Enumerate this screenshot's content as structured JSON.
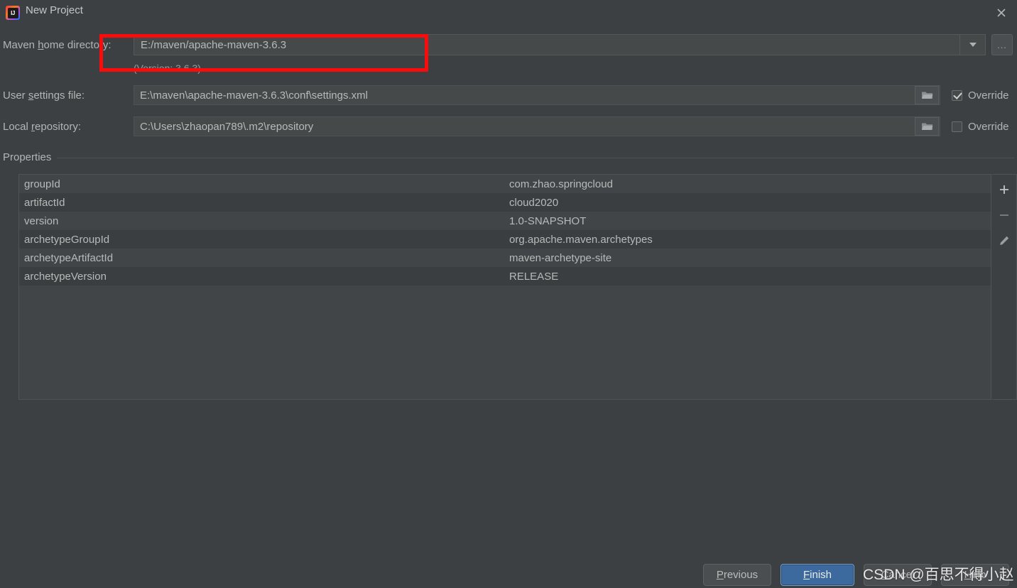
{
  "window": {
    "title": "New Project",
    "app_icon": "intellij-idea-icon",
    "close_icon": "close-icon"
  },
  "form": {
    "maven_home": {
      "label_prefix": "Maven ",
      "label_mnemonic": "h",
      "label_suffix": "ome directory:",
      "value": "E:/maven/apache-maven-3.6.3",
      "version_note": "(Version: 3.6.3)",
      "dropdown_icon": "chevron-down-icon",
      "ellipsis_label": "..."
    },
    "user_settings": {
      "label_prefix": "User ",
      "label_mnemonic": "s",
      "label_suffix": "ettings file:",
      "value": "E:\\maven\\apache-maven-3.6.3\\conf\\settings.xml",
      "browse_icon": "folder-icon",
      "override_label": "Override",
      "override_checked": true
    },
    "local_repository": {
      "label_prefix": "Local ",
      "label_mnemonic": "r",
      "label_suffix": "epository:",
      "value": "C:\\Users\\zhaopan789\\.m2\\repository",
      "browse_icon": "folder-icon",
      "override_label": "Override",
      "override_checked": false
    }
  },
  "properties": {
    "section_label": "Properties",
    "rows": [
      {
        "name": "groupId",
        "value": "com.zhao.springcloud"
      },
      {
        "name": "artifactId",
        "value": "cloud2020"
      },
      {
        "name": "version",
        "value": "1.0-SNAPSHOT"
      },
      {
        "name": "archetypeGroupId",
        "value": "org.apache.maven.archetypes"
      },
      {
        "name": "archetypeArtifactId",
        "value": "maven-archetype-site"
      },
      {
        "name": "archetypeVersion",
        "value": "RELEASE"
      }
    ],
    "toolbar": {
      "add_icon": "plus-icon",
      "remove_icon": "minus-icon",
      "edit_icon": "pencil-icon"
    }
  },
  "footer": {
    "previous": {
      "prefix": "",
      "mnemonic": "P",
      "suffix": "revious"
    },
    "finish": {
      "prefix": "",
      "mnemonic": "F",
      "suffix": "inish"
    },
    "cancel": {
      "prefix": "",
      "mnemonic": "C",
      "suffix": "ancel"
    },
    "help": {
      "prefix": "",
      "mnemonic": "H",
      "suffix": "elp"
    }
  },
  "watermark": "CSDN @百思不得小赵",
  "annotation": {
    "color": "#fb0b0b"
  },
  "colors": {
    "background": "#3c4043",
    "field_background": "#45494a",
    "row_odd": "#414548",
    "row_even": "#3a3e40",
    "accent": "#3c6a9e",
    "text": "#b9b9b9"
  }
}
